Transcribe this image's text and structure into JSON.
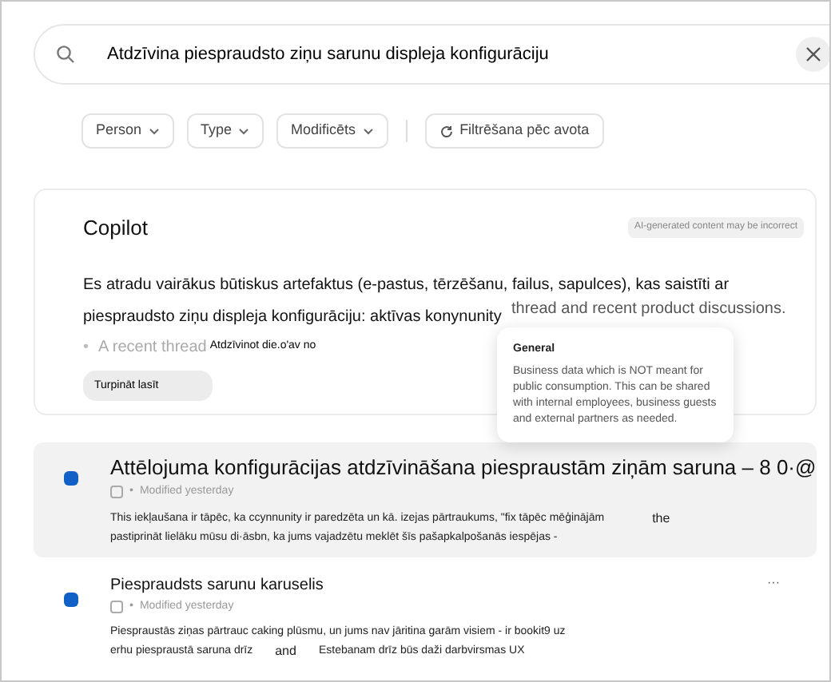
{
  "search": {
    "value": "Atdzīvina piespraudsto ziņu sarunu displeja konfigurāciju"
  },
  "filters": [
    {
      "label": "Person",
      "kind": "dropdown"
    },
    {
      "label": "Type",
      "kind": "dropdown"
    },
    {
      "label": "Modificēts",
      "kind": "dropdown"
    },
    {
      "label": "Filtrēšana pēc avota",
      "kind": "source"
    }
  ],
  "copilot": {
    "title": "Copilot",
    "disclaimer": "AI-generated content may be incorrect",
    "paragraph": [
      "Es atradu vairākus būtiskus artefaktus (e-pastus, tērzēšanu, failus, sapulces), kas saistīti ar",
      "piespraudsto ziņu displeja konfigurāciju: aktīvas konynunity"
    ],
    "overlap_text": "thread and recent product discussions.",
    "bullet_mark": "•",
    "bullet": "A recent thread",
    "bullet_overlay": "Atdzīvinot die.o'av no",
    "continue_button": "Turpināt lasīt"
  },
  "tooltip": {
    "title": "General",
    "body": "Business data which is NOT meant for public consumption. This can be shared with internal employees, business guests and external partners as needed."
  },
  "results": [
    {
      "title": "Attēlojuma konfigurācijas atdzīvināšana piespraustām ziņām saruna – 8 0·@",
      "separator": "•",
      "meta": "Modified yesterday",
      "selected": true,
      "snippet": [
        [
          "This iekļaušana ir tāpēc, ka ccynnunity ir paredzēta un kā. izejas pārtraukums, \"fix tāpēc mēģinājām",
          "the"
        ],
        [
          "pastiprināt lielāku mūsu di·āsbn, ka jums vajadzētu meklēt šīs pašapkalpošanās iespējas -"
        ]
      ]
    },
    {
      "title": "Piespraudsts sarunu karuselis",
      "separator": "•",
      "meta": "Modified yesterday",
      "selected": false,
      "more": "···",
      "snippet": [
        [
          "Piespraustās ziņas pārtrauc caking plūsmu, un jums nav jāritina garām visiem - ir bookit9 uz"
        ],
        [
          "erhu piespraustā saruna drīz",
          "and",
          "Estebanam drīz būs daži darbvirsmas UX"
        ]
      ]
    }
  ]
}
